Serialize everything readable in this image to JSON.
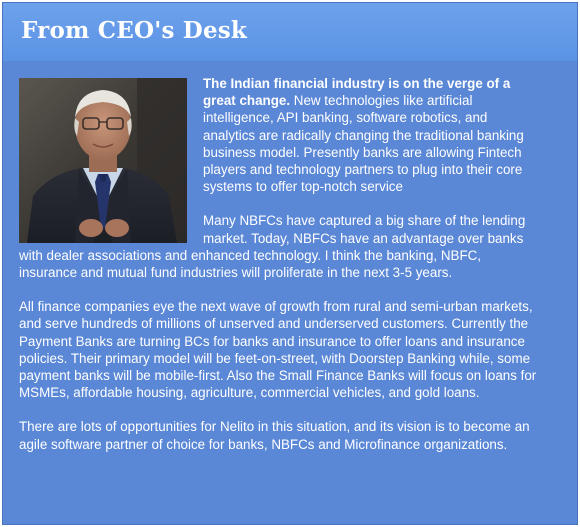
{
  "header": {
    "title": "From CEO's Desk"
  },
  "photo": {
    "icon": "ceo-portrait"
  },
  "article": {
    "lead": "The Indian financial industry is on the verge of a great change.",
    "p1_rest": " New technologies like artificial intelligence, API banking, software robotics, and analytics are radically changing the traditional banking business model. Presently banks are allowing Fintech players and technology partners to plug into their core systems to offer top-notch service",
    "p2": "Many NBFCs have captured a big share of the lending market. Today, NBFCs have an advantage over banks with dealer associations and enhanced technology. I think the banking, NBFC, insurance and mutual fund industries will proliferate in the next 3-5 years.",
    "p3": "All finance companies eye the next wave of growth from rural and semi-urban markets, and serve hundreds of millions of unserved and underserved customers. Currently the Payment Banks are turning BCs for banks and insurance to offer loans and insurance policies. Their primary model will be feet-on-street, with Doorstep Banking while, some payment banks will be mobile-first. Also the Small Finance Banks will focus on loans for MSMEs, affordable housing, agriculture, commercial vehicles, and gold loans.",
    "p4": "There are lots of opportunities for Nelito in this situation, and its vision is to become an agile software partner of choice for banks, NBFCs and Microfinance organizations."
  },
  "colors": {
    "panel": "#5a87d6",
    "header": "#6da1ec",
    "text": "#ffffff"
  }
}
